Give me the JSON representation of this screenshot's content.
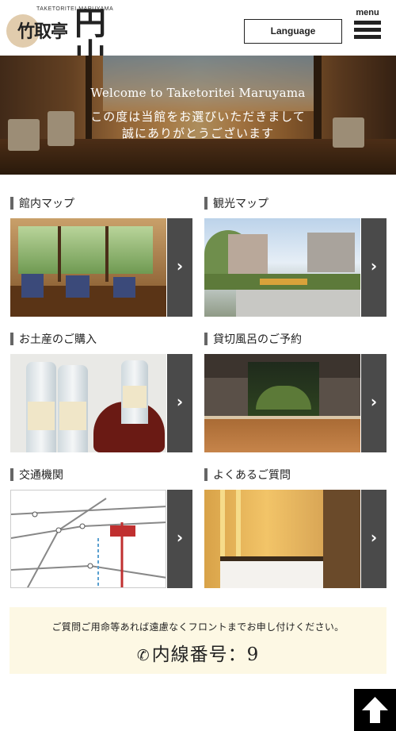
{
  "header": {
    "logo_small": "TAKETORITEI MARUYAMA",
    "logo_main": "竹取亭",
    "logo_script": "円山",
    "language_label": "Language",
    "menu_label": "menu"
  },
  "hero": {
    "title": "Welcome to Taketoritei Maruyama",
    "line1": "この度は当館をお選びいただきまして",
    "line2": "誠にありがとうございます"
  },
  "tiles": [
    {
      "title": "館内マップ"
    },
    {
      "title": "観光マップ"
    },
    {
      "title": "お土産のご購入"
    },
    {
      "title": "貸切風呂のご予約"
    },
    {
      "title": "交通機関"
    },
    {
      "title": "よくあるご質問"
    }
  ],
  "info": {
    "text": "ご質問ご用命等あれば遠慮なくフロントまでお申し付けください。",
    "phone_icon": "phone-icon",
    "phone": "内線番号：9"
  },
  "icons": {
    "arrow": "chevron-right-icon",
    "pagetop": "arrow-up-icon",
    "menu": "hamburger-icon"
  },
  "colors": {
    "arrow_bg": "#4a4a4a",
    "info_bg": "#fdf8e4",
    "pagetop_bg": "#000000"
  }
}
